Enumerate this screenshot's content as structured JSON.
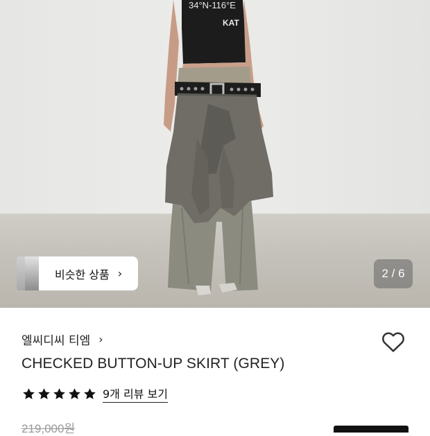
{
  "hero": {
    "shirt_text_line1": "34°N-116°E",
    "shirt_text_line2": "KAT",
    "counter": "2 / 6"
  },
  "similar_products": {
    "label": "비슷한 상품",
    "chevron": "›"
  },
  "product": {
    "brand": "엘씨디씨 티엠",
    "brand_chevron": "›",
    "title": "CHECKED BUTTON-UP SKIRT (GREY)",
    "rating_stars": 5,
    "reviews_label": "9개 리뷰 보기",
    "original_price": "219,000원"
  },
  "icons": {
    "favorite": "heart-outline-icon",
    "star": "star-filled-icon"
  },
  "colors": {
    "text": "#111111",
    "muted_price": "#999999",
    "counter_bg": "rgba(100,100,100,0.55)"
  }
}
